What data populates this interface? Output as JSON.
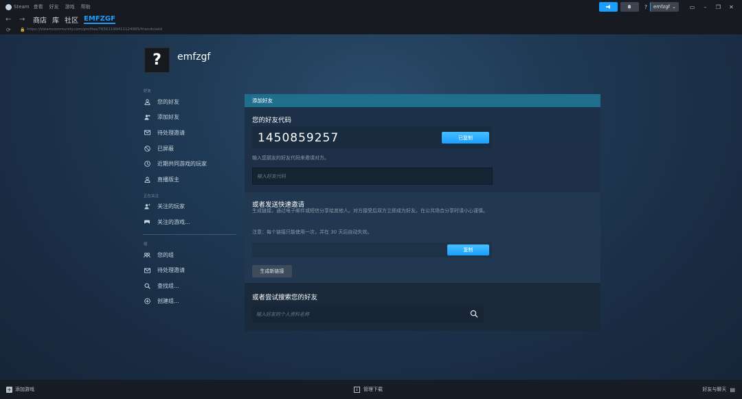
{
  "topbar": {
    "app_name": "Steam",
    "menu": [
      "查看",
      "好友",
      "游戏",
      "帮助"
    ],
    "user": "emfzgf",
    "help_glyph": "?"
  },
  "nav": {
    "tabs": [
      "商店",
      "库",
      "社区",
      "EMFZGF"
    ],
    "active_tab": "EMFZGF",
    "url": "https://steamcommunity.com/profiles/76561199411124985/friends/add"
  },
  "profile": {
    "name": "emfzgf",
    "avatar_glyph": "?"
  },
  "sidebar": {
    "sections": [
      {
        "heading": "好友",
        "items": [
          {
            "label": "您的好友",
            "icon": "person-icon"
          },
          {
            "label": "添加好友",
            "icon": "add-person-icon"
          },
          {
            "label": "待处理邀请",
            "icon": "envelope-icon"
          },
          {
            "label": "已屏蔽",
            "icon": "blocked-icon"
          },
          {
            "label": "近期共同游戏的玩家",
            "icon": "clock-icon"
          },
          {
            "label": "直播版主",
            "icon": "person-icon"
          }
        ]
      },
      {
        "heading": "正在关注",
        "items": [
          {
            "label": "关注的玩家",
            "icon": "followed-person-icon"
          },
          {
            "label": "关注的游戏...",
            "icon": "gamepad-icon"
          }
        ]
      },
      {
        "heading": "组",
        "items": [
          {
            "label": "您的组",
            "icon": "group-icon"
          },
          {
            "label": "待处理邀请",
            "icon": "envelope-icon"
          },
          {
            "label": "查找组...",
            "icon": "search-icon"
          },
          {
            "label": "创建组...",
            "icon": "plus-circle-icon"
          }
        ]
      }
    ]
  },
  "add_friend": {
    "header": "添加好友",
    "code_title": "您的好友代码",
    "friend_code": "1450859257",
    "copied_label": "已复制",
    "code_hint": "输入您朋友的好友代码来邀请对方。",
    "code_placeholder": "输入好友代码",
    "invite_title": "或者发送快速邀请",
    "invite_desc": "生成链接，通过电子邮件或短信分享给其他人。对方接受后双方立即成为好友。在公共场合分享时请小心谨慎。",
    "invite_note": "注意：每个链接只能使用一次，并在 30 天后自动失效。",
    "copy_label": "复制",
    "generate_label": "生成新链接",
    "search_title": "或者尝试搜索您的好友",
    "search_placeholder": "输入好友的个人资料名称"
  },
  "bottombar": {
    "add_game": "添加游戏",
    "manage_downloads": "管理下载",
    "friends_chat": "好友与聊天"
  },
  "colors": {
    "accent": "#1a9fff",
    "panel_header": "#1f6f8c",
    "background": "#1b2838"
  }
}
